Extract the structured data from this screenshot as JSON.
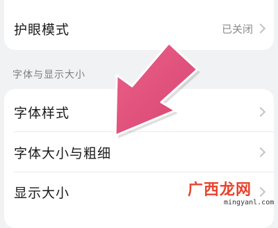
{
  "settings": {
    "eye_protection": {
      "label": "护眼模式",
      "value": "已关闭"
    },
    "section_title": "字体与显示大小",
    "items": [
      {
        "label": "字体样式"
      },
      {
        "label": "字体大小与粗细"
      },
      {
        "label": "显示大小"
      }
    ]
  },
  "overlay": {
    "arrow_icon": "pointing-arrow-icon",
    "arrow_color": "#e0527e",
    "watermark_brand": "广西龙网",
    "watermark_url": "mingyanl.com"
  },
  "icons": {
    "chevron": "chevron-right-icon"
  }
}
